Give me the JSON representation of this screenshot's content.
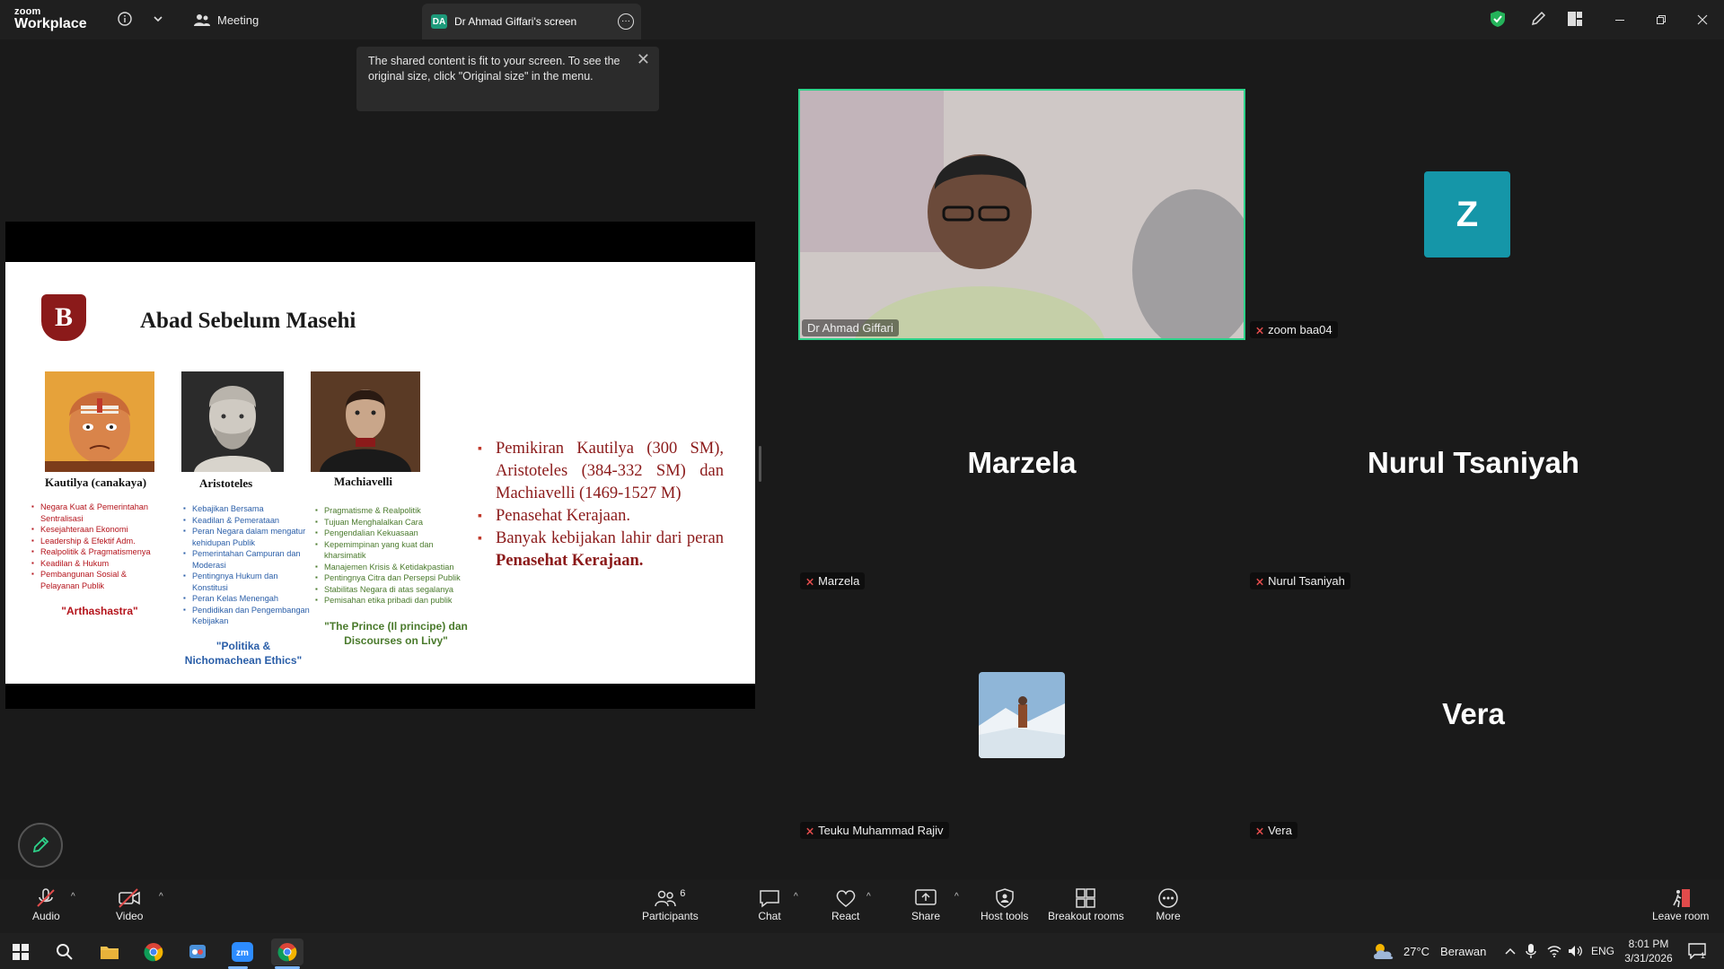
{
  "header": {
    "logo_line1": "zoom",
    "logo_line2": "Workplace",
    "meeting_label": "Meeting",
    "share_tab_initials": "DA",
    "share_tab_label": "Dr Ahmad Giffari's screen"
  },
  "tooltip": {
    "text": "The shared content is fit to your screen. To see the original size, click \"Original size\" in the menu."
  },
  "slide": {
    "title": "Abad Sebelum Masehi",
    "logo_letter": "B",
    "people": [
      {
        "name": "Kautilya  (canakaya)",
        "bullets": [
          "Negara Kuat & Pemerintahan Sentralisasi",
          "Kesejahteraan Ekonomi",
          "Leadership & Efektif Adm.",
          "Realpolitik & Pragmatismenya",
          "Keadilan & Hukum",
          "Pembangunan Sosial & Pelayanan Publik"
        ],
        "quote": "\"Arthashastra\""
      },
      {
        "name": "Aristoteles",
        "bullets": [
          "Kebajikan Bersama",
          "Keadilan & Pemerataan",
          "Peran Negara dalam mengatur kehidupan Publik",
          "Pemerintahan Campuran dan Moderasi",
          "Pentingnya Hukum dan Konstitusi",
          "Peran Kelas Menengah",
          "Pendidikan dan Pengembangan Kebijakan"
        ],
        "quote": "\"Politika & Nichomachean Ethics\""
      },
      {
        "name": "Machiavelli",
        "bullets": [
          "Pragmatisme & Realpolitik",
          "Tujuan Menghalalkan Cara",
          "Pengendalian Kekuasaan",
          "Kepemimpinan yang kuat dan kharsimatik",
          "Manajemen Krisis & Ketidakpastian",
          "Pentingnya Citra dan Persepsi Publik",
          "Stabilitas Negara di atas segalanya",
          "Pemisahan etika pribadi dan publik"
        ],
        "quote": "\"The Prince (Il principe) dan Discourses on Livy\""
      }
    ],
    "right_points": [
      "Pemikiran Kautilya (300 SM), Aristoteles (384-332 SM) dan Machiavelli (1469-1527 M)",
      "Penasehat Kerajaan.",
      "Banyak kebijakan lahir dari peran "
    ],
    "right_points_bold": "Penasehat Kerajaan."
  },
  "participants_tiles": {
    "speaker_name": "Dr Ahmad Giffari",
    "zoom_tile_initial": "Z",
    "zoom_tile_name": "zoom baa04",
    "marzela_big": "Marzela",
    "marzela_tag": "Marzela",
    "nurul_big": "Nurul Tsaniyah",
    "nurul_tag": "Nurul Tsaniyah",
    "teuku_tag": "Teuku Muhammad Rajiv",
    "vera_big": "Vera",
    "vera_tag": "Vera"
  },
  "toolbar": {
    "audio": "Audio",
    "video": "Video",
    "participants": "Participants",
    "participants_count": "6",
    "chat": "Chat",
    "react": "React",
    "share": "Share",
    "host_tools": "Host tools",
    "breakout_rooms": "Breakout rooms",
    "more": "More",
    "leave_room": "Leave room"
  },
  "taskbar": {
    "weather_temp": "27°C",
    "weather_desc": "Berawan",
    "lang": "ENG",
    "time": "8:01 PM",
    "date": "3/31/2026",
    "notif_count": "1"
  },
  "colors": {
    "accent_green": "#1d9a7a",
    "speaker_border": "#2ed28a",
    "slide_red": "#8b1a1a",
    "blue_text": "#2a5ea8",
    "green_text": "#4a7a2c",
    "z_tile": "#1596a8"
  }
}
